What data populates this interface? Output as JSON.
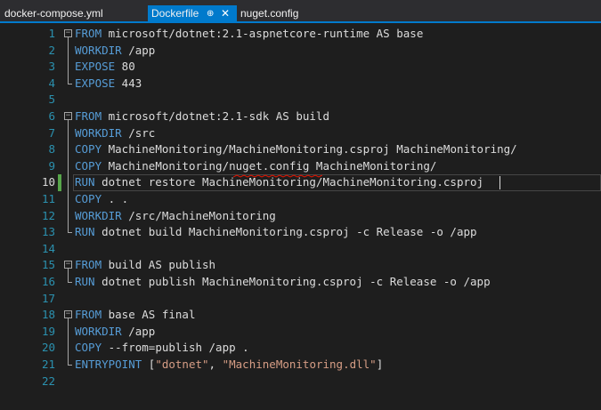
{
  "tabs": [
    {
      "label": "docker-compose.yml",
      "active": false
    },
    {
      "label": "Dockerfile",
      "active": true,
      "pin_glyph": "⊕",
      "close_glyph": "✕"
    },
    {
      "label": "nuget.config",
      "active": false
    }
  ],
  "editor": {
    "current_line": 10,
    "lines": [
      {
        "n": "1",
        "kw": "FROM",
        "rest": " microsoft/dotnet:2.1-aspnetcore-runtime AS base"
      },
      {
        "n": "2",
        "kw": "WORKDIR",
        "rest": " /app"
      },
      {
        "n": "3",
        "kw": "EXPOSE",
        "rest": " 80"
      },
      {
        "n": "4",
        "kw": "EXPOSE",
        "rest": " 443"
      },
      {
        "n": "5",
        "kw": "",
        "rest": ""
      },
      {
        "n": "6",
        "kw": "FROM",
        "rest": " microsoft/dotnet:2.1-sdk AS build"
      },
      {
        "n": "7",
        "kw": "WORKDIR",
        "rest": " /src"
      },
      {
        "n": "8",
        "kw": "COPY",
        "rest": " MachineMonitoring/MachineMonitoring.csproj MachineMonitoring/"
      },
      {
        "n": "9",
        "kw": "COPY",
        "rest": " MachineMonitoring/nuget.config MachineMonitoring/"
      },
      {
        "n": "10",
        "kw": "RUN",
        "rest": " dotnet restore MachineMonitoring/MachineMonitoring.csproj"
      },
      {
        "n": "11",
        "kw": "COPY",
        "rest": " . ."
      },
      {
        "n": "12",
        "kw": "WORKDIR",
        "rest": " /src/MachineMonitoring"
      },
      {
        "n": "13",
        "kw": "RUN",
        "rest": " dotnet build MachineMonitoring.csproj -c Release -o /app"
      },
      {
        "n": "14",
        "kw": "",
        "rest": ""
      },
      {
        "n": "15",
        "kw": "FROM",
        "rest": " build AS publish"
      },
      {
        "n": "16",
        "kw": "RUN",
        "rest": " dotnet publish MachineMonitoring.csproj -c Release -o /app"
      },
      {
        "n": "17",
        "kw": "",
        "rest": ""
      },
      {
        "n": "18",
        "kw": "FROM",
        "rest": " base AS final"
      },
      {
        "n": "19",
        "kw": "WORKDIR",
        "rest": " /app"
      },
      {
        "n": "20",
        "kw": "COPY",
        "rest": " --from=publish /app ."
      },
      {
        "n": "21",
        "kw": "ENTRYPOINT",
        "rest": " [",
        "s1": "\"dotnet\"",
        "mid": ", ",
        "s2": "\"MachineMonitoring.dll\"",
        "tail": "]"
      },
      {
        "n": "22",
        "kw": "",
        "rest": ""
      }
    ]
  },
  "colors": {
    "keyword": "#569cd6",
    "text": "#dcdcdc",
    "string": "#d69d85",
    "line_number": "#2b91af",
    "accent": "#007acc",
    "change_bar": "#57a64a",
    "squiggle": "#e51400"
  }
}
